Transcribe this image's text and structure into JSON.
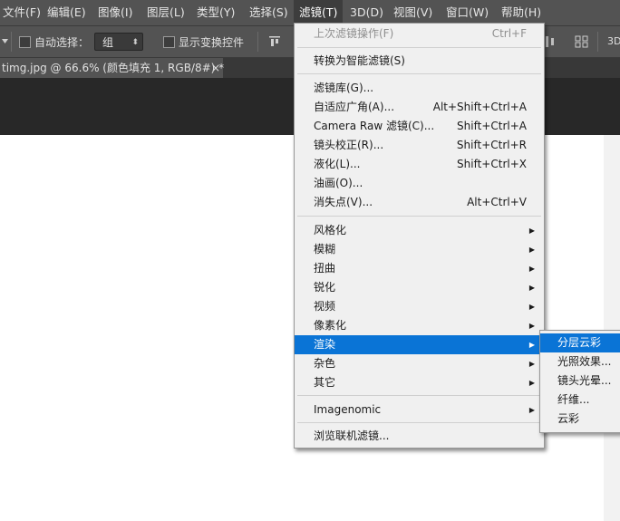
{
  "menubar": {
    "items": [
      {
        "label": "文件(F)"
      },
      {
        "label": "编辑(E)"
      },
      {
        "label": "图像(I)"
      },
      {
        "label": "图层(L)"
      },
      {
        "label": "类型(Y)"
      },
      {
        "label": "选择(S)"
      },
      {
        "label": "滤镜(T)"
      },
      {
        "label": "3D(D)"
      },
      {
        "label": "视图(V)"
      },
      {
        "label": "窗口(W)"
      },
      {
        "label": "帮助(H)"
      }
    ]
  },
  "options": {
    "auto_select_label": "自动选择：",
    "group_value": "组",
    "show_transform_label": "显示变换控件",
    "three_d_label": "3D"
  },
  "tab": {
    "title": "timg.jpg @ 66.6% (颜色填充 1, RGB/8#) *",
    "close": "×"
  },
  "filter_menu": {
    "last_filter": {
      "label": "上次滤镜操作(F)",
      "shortcut": "Ctrl+F"
    },
    "smart_filter": {
      "label": "转换为智能滤镜(S)"
    },
    "group1": [
      {
        "label": "滤镜库(G)...",
        "shortcut": ""
      },
      {
        "label": "自适应广角(A)...",
        "shortcut": "Alt+Shift+Ctrl+A"
      },
      {
        "label": "Camera Raw 滤镜(C)...",
        "shortcut": "Shift+Ctrl+A"
      },
      {
        "label": "镜头校正(R)...",
        "shortcut": "Shift+Ctrl+R"
      },
      {
        "label": "液化(L)...",
        "shortcut": "Shift+Ctrl+X"
      },
      {
        "label": "油画(O)...",
        "shortcut": ""
      },
      {
        "label": "消失点(V)...",
        "shortcut": "Alt+Ctrl+V"
      }
    ],
    "group2": [
      {
        "label": "风格化"
      },
      {
        "label": "模糊"
      },
      {
        "label": "扭曲"
      },
      {
        "label": "锐化"
      },
      {
        "label": "视频"
      },
      {
        "label": "像素化"
      },
      {
        "label": "渲染"
      },
      {
        "label": "杂色"
      },
      {
        "label": "其它"
      }
    ],
    "imagenomic": {
      "label": "Imagenomic"
    },
    "browse": {
      "label": "浏览联机滤镜..."
    },
    "submenu_arrow": "▶"
  },
  "render_submenu": {
    "items": [
      {
        "label": "分层云彩"
      },
      {
        "label": "光照效果..."
      },
      {
        "label": "镜头光晕..."
      },
      {
        "label": "纤维..."
      },
      {
        "label": "云彩"
      }
    ]
  },
  "colors": {
    "highlight": "#0a74d6",
    "menubar_bg": "#535353",
    "menu_bg": "#f0f0f0"
  }
}
